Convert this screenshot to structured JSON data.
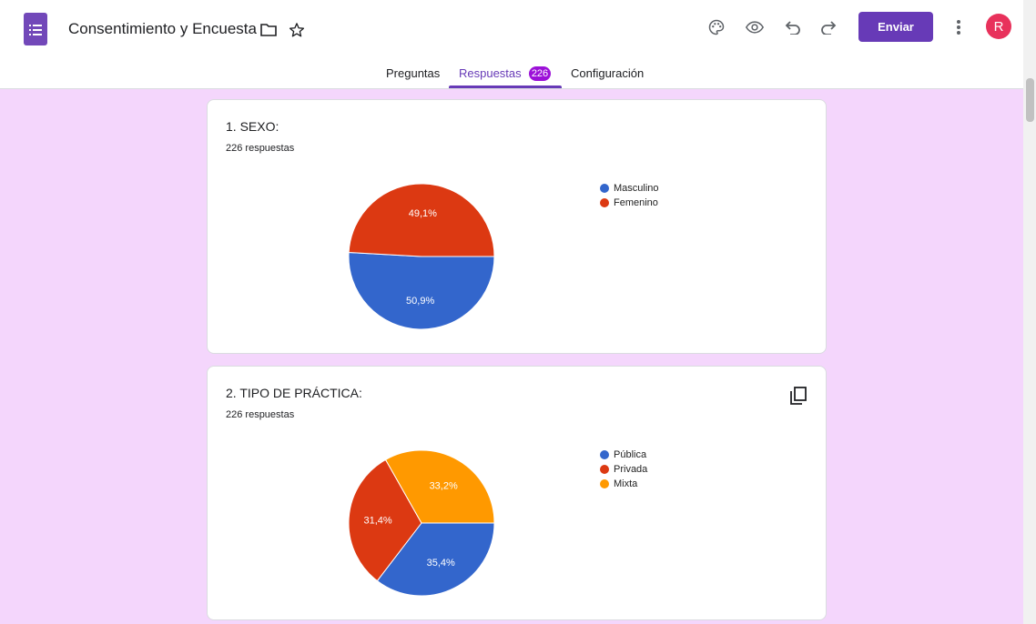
{
  "header": {
    "title": "Consentimiento y Encuesta",
    "send_label": "Enviar",
    "avatar_initial": "R",
    "icons": [
      "forms-app-icon",
      "folder-icon",
      "star-icon",
      "palette-icon",
      "preview-eye-icon",
      "undo-icon",
      "redo-icon",
      "more-vert-icon"
    ]
  },
  "tabs": [
    {
      "label": "Preguntas"
    },
    {
      "label": "Respuestas",
      "badge": "226",
      "active": true
    },
    {
      "label": "Configuración"
    }
  ],
  "colors": {
    "accent": "#673ab7",
    "badge": "#9c11d8",
    "background": "#f4d6fc",
    "avatar": "#e8315b"
  },
  "questions": [
    {
      "title": "1. SEXO:",
      "responses": "226 respuestas",
      "chart_data": {
        "type": "pie",
        "legend_position": "right",
        "slices": [
          {
            "label": "Masculino",
            "value": 50.9,
            "display": "50,9%",
            "color": "#3366cc"
          },
          {
            "label": "Femenino",
            "value": 49.1,
            "display": "49,1%",
            "color": "#dc3912"
          }
        ]
      }
    },
    {
      "title": "2. TIPO DE PRÁCTICA:",
      "responses": "226 respuestas",
      "has_copy_icon": true,
      "chart_data": {
        "type": "pie",
        "legend_position": "right",
        "slices": [
          {
            "label": "Pública",
            "value": 35.4,
            "display": "35,4%",
            "color": "#3366cc"
          },
          {
            "label": "Privada",
            "value": 31.4,
            "display": "31,4%",
            "color": "#dc3912"
          },
          {
            "label": "Mixta",
            "value": 33.2,
            "display": "33,2%",
            "color": "#ff9900"
          }
        ]
      }
    }
  ]
}
